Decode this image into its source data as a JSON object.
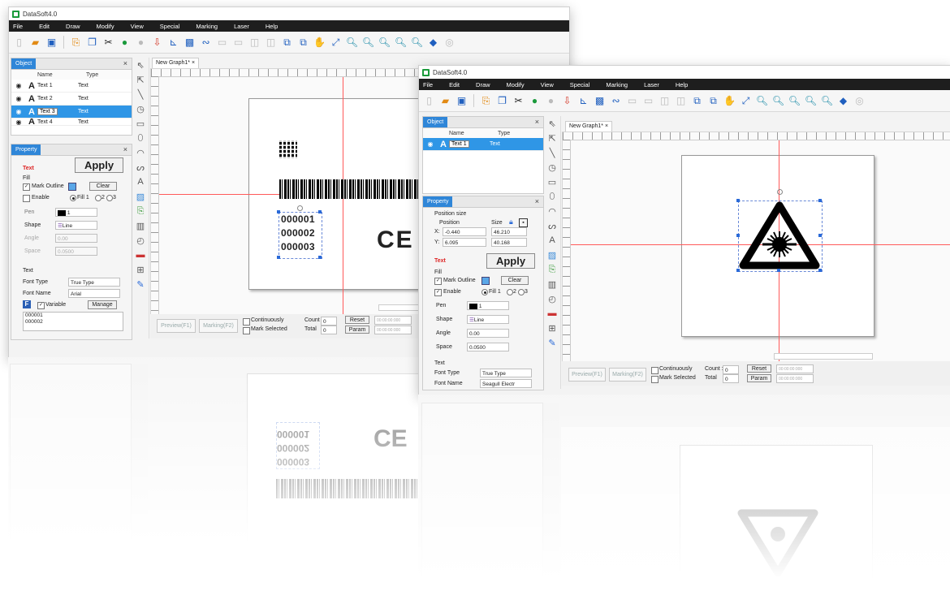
{
  "app": {
    "title": "DataSoft4.0"
  },
  "menu": [
    "File",
    "Edit",
    "Draw",
    "Modify",
    "View",
    "Special",
    "Marking",
    "Laser",
    "Help"
  ],
  "left_window": {
    "doc_tab": "New Graph1*",
    "object_panel": {
      "title": "Object",
      "col_name": "Name",
      "col_type": "Type",
      "rows": [
        {
          "name": "Text 1",
          "type": "Text"
        },
        {
          "name": "Text 2",
          "type": "Text"
        },
        {
          "name": "Text 3",
          "type": "Text"
        },
        {
          "name": "Text 4",
          "type": "Text"
        }
      ]
    },
    "property_panel": {
      "title": "Property",
      "section_text": "Text",
      "apply": "Apply",
      "fill": "Fill",
      "mark_outline": "Mark Outline",
      "clear": "Clear",
      "enable": "Enable",
      "fill1": "Fill 1",
      "fill2": "2",
      "fill3": "3",
      "pen_label": "Pen",
      "pen_value": "1",
      "shape_label": "Shape",
      "shape_value": "Line",
      "angle_label": "Angle",
      "angle_value": "0.00",
      "space_label": "Space",
      "space_value": "0.0500",
      "text_header": "Text",
      "font_type_label": "Font Type",
      "font_type_value": "True Type",
      "font_name_label": "Font Name",
      "font_name_value": "Arial",
      "variable": "Variable",
      "manage": "Manage",
      "variable_lines": [
        "000001",
        "000002"
      ]
    },
    "canvas": {
      "serials": [
        "000001",
        "000002",
        "000003"
      ],
      "ce_mark": "CE"
    },
    "status": {
      "preview": "Preview(F1)",
      "marking": "Marking(F2)",
      "continuously": "Continuously",
      "mark_selected": "Mark Selected",
      "count_label": "Count :",
      "count_value": "0",
      "total_label": "Total",
      "total_value": "0",
      "reset": "Reset",
      "param": "Param",
      "time1": "00:00:00:000",
      "time2": "00:00:00:000"
    }
  },
  "right_window": {
    "doc_tab": "New Graph1*",
    "object_panel": {
      "title": "Object",
      "col_name": "Name",
      "col_type": "Type",
      "rows": [
        {
          "name": "Text 1",
          "type": "Text"
        }
      ]
    },
    "property_panel": {
      "title": "Property",
      "position_size": "Position size",
      "position": "Position",
      "size": "Size",
      "x_label": "X:",
      "x_value": "-0.440",
      "y_label": "Y:",
      "y_value": "6.095",
      "w_value": "46.210",
      "h_value": "40.168",
      "section_text": "Text",
      "apply": "Apply",
      "fill": "Fill",
      "mark_outline": "Mark Outline",
      "clear": "Clear",
      "enable": "Enable",
      "fill1": "Fill 1",
      "fill2": "2",
      "fill3": "3",
      "pen_label": "Pen",
      "pen_value": "1",
      "shape_label": "Shape",
      "shape_value": "Line",
      "angle_label": "Angle",
      "angle_value": "0.00",
      "space_label": "Space",
      "space_value": "0.0500",
      "text_header": "Text",
      "font_type_label": "Font Type",
      "font_type_value": "True Type",
      "font_name_label": "Font Name",
      "font_name_value": "Seagull Electr"
    },
    "status": {
      "preview": "Preview(F1)",
      "marking": "Marking(F2)",
      "continuously": "Continuously",
      "mark_selected": "Mark Selected",
      "count_label": "Count :",
      "count_value": "0",
      "total_label": "Total",
      "total_value": "0",
      "reset": "Reset",
      "param": "Param",
      "time1": "00:00:00:000",
      "time2": "00:00:00:000"
    }
  },
  "colors": {
    "menubar": "#1e1e1e",
    "selection": "#2f96e6",
    "tab_blue": "#2f86d8",
    "guide_red": "#ff5a5a",
    "label_red": "#d22222"
  }
}
